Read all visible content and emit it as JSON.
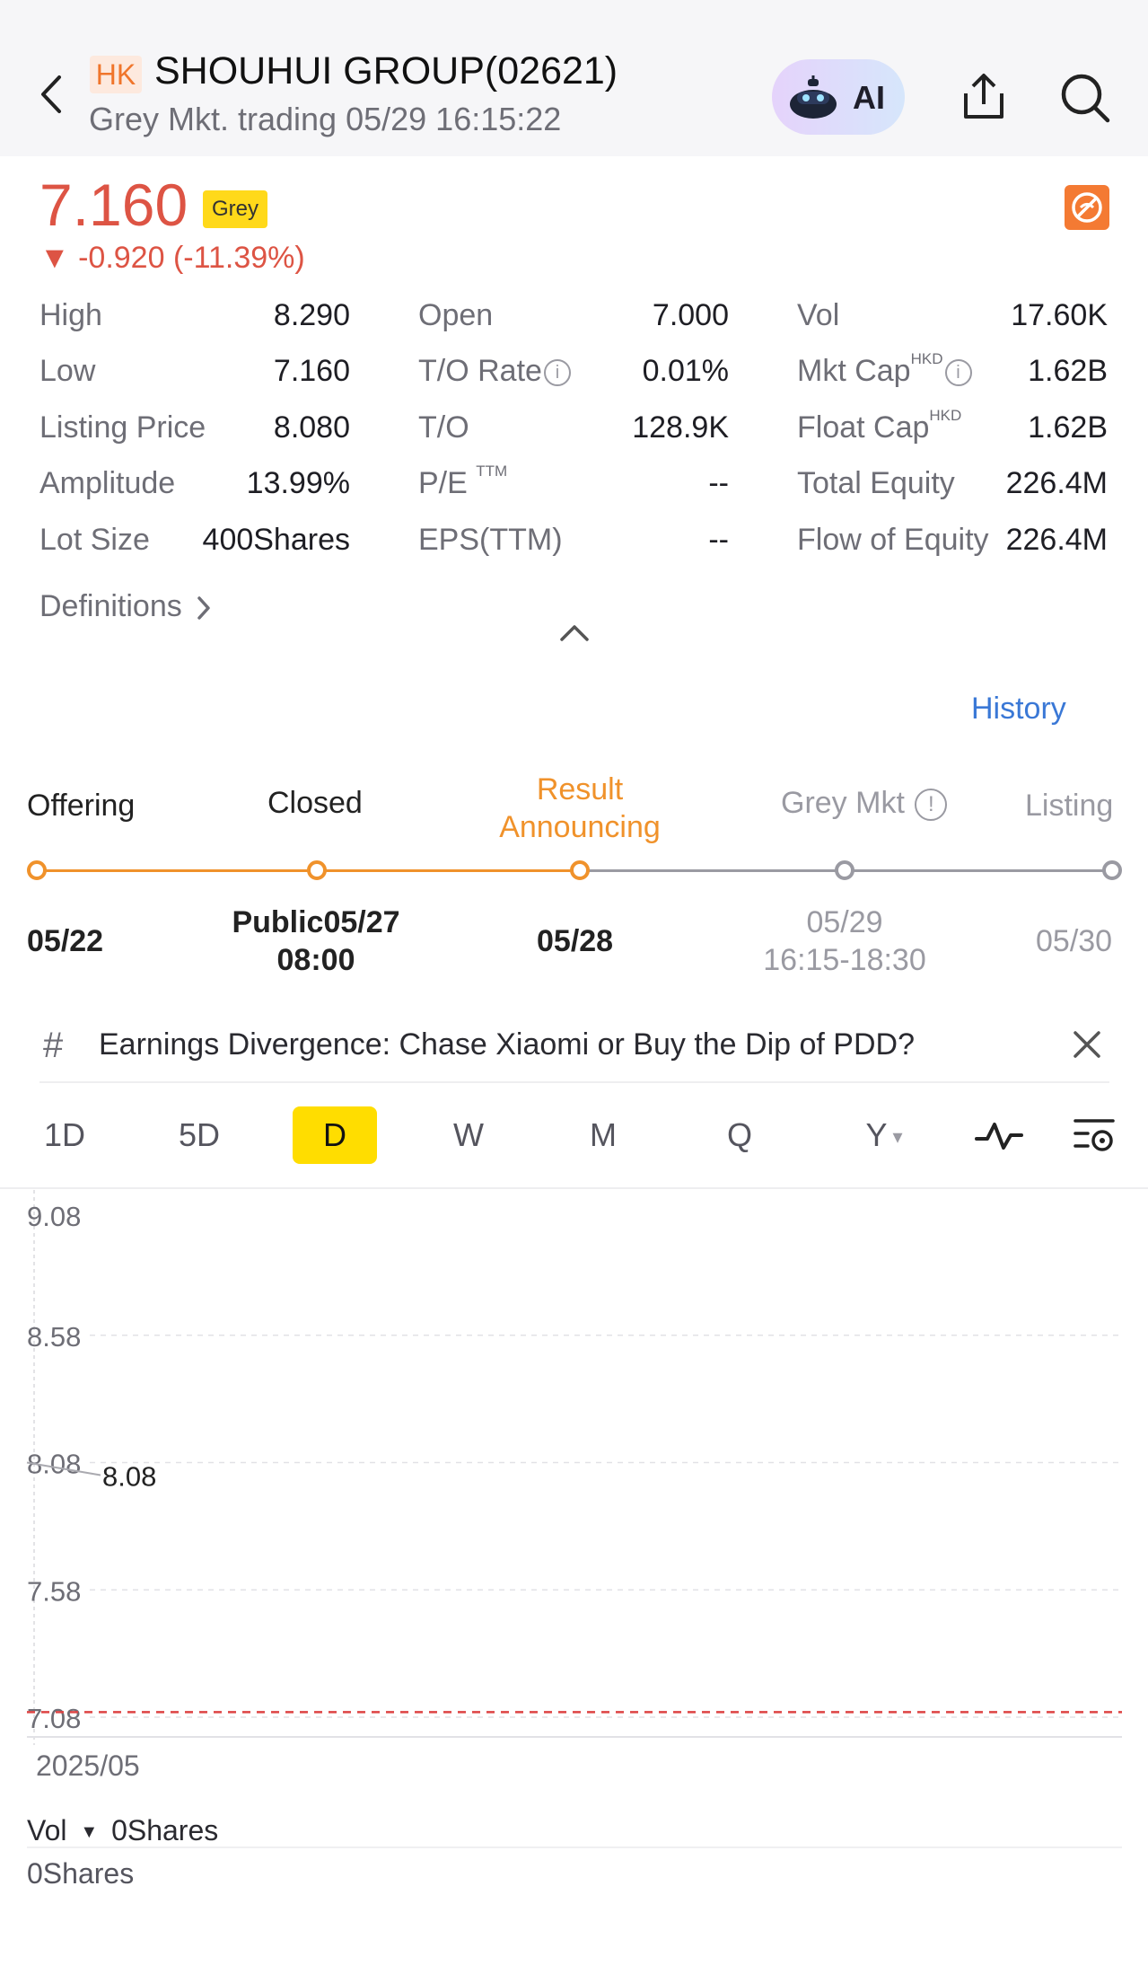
{
  "header": {
    "market_badge": "HK",
    "title": "SHOUHUI GROUP(02621)",
    "subtitle": "Grey Mkt. trading 05/29 16:15:22",
    "ai_label": "AI"
  },
  "quote": {
    "price": "7.160",
    "price_badge": "Grey",
    "change": "▼ -0.920 (-11.39%)",
    "colors": {
      "down": "#dd5444",
      "accent": "#f0922b"
    }
  },
  "stats": {
    "col1": [
      {
        "label": "High",
        "value": "8.290"
      },
      {
        "label": "Low",
        "value": "7.160"
      },
      {
        "label": "Listing Price",
        "value": "8.080"
      },
      {
        "label": "Amplitude",
        "value": "13.99%"
      },
      {
        "label": "Lot Size",
        "value": "400Shares"
      }
    ],
    "col2": [
      {
        "label": "Open",
        "value": "7.000"
      },
      {
        "label": "T/O Rate",
        "value": "0.01%"
      },
      {
        "label": "T/O",
        "value": "128.9K"
      },
      {
        "label": "P/E",
        "sup": "TTM",
        "value": "--"
      },
      {
        "label": "EPS(TTM)",
        "value": "--"
      }
    ],
    "col3": [
      {
        "label": "Vol",
        "value": "17.60K"
      },
      {
        "label": "Mkt Cap",
        "sup": "HKD",
        "value": "1.62B"
      },
      {
        "label": "Float Cap",
        "sup": "HKD",
        "value": "1.62B"
      },
      {
        "label": "Total Equity",
        "value": "226.4M"
      },
      {
        "label": "Flow of Equity",
        "value": "226.4M"
      }
    ],
    "info_glyph": "i"
  },
  "definitions_label": "Definitions",
  "history_label": "History",
  "timeline": {
    "stages": [
      {
        "label": "Offering",
        "date": "05/22",
        "state": "done"
      },
      {
        "label": "Closed",
        "date": "Public05/27",
        "date2": "08:00",
        "state": "done"
      },
      {
        "label": "Result",
        "label2": "Announcing",
        "date": "05/28",
        "state": "current"
      },
      {
        "label": "Grey Mkt",
        "date": "05/29",
        "date2": "16:15-18:30",
        "state": "pending"
      },
      {
        "label": "Listing",
        "date": "05/30",
        "state": "pending"
      }
    ],
    "grey_info_glyph": "!"
  },
  "news": {
    "hash": "#",
    "text": "Earnings Divergence: Chase Xiaomi or Buy the Dip of PDD?"
  },
  "chart_tabs": {
    "items": [
      "1D",
      "5D",
      "D",
      "W",
      "M",
      "Q",
      "Y"
    ],
    "active": "D",
    "y_dropdown_glyph": "▾"
  },
  "chart_data": {
    "type": "line",
    "y_ticks": [
      "9.08",
      "8.58",
      "8.08",
      "7.58",
      "7.08"
    ],
    "ylim": [
      7.08,
      9.08
    ],
    "x_label": "2025/05",
    "series": [
      {
        "values": [
          8.08,
          8.08
        ]
      }
    ],
    "point_label": "8.08",
    "reference_line": 7.1,
    "reference_color": "#dd4444",
    "grid": true
  },
  "volume": {
    "label": "Vol",
    "value": "0Shares",
    "axis_label": "0Shares"
  }
}
